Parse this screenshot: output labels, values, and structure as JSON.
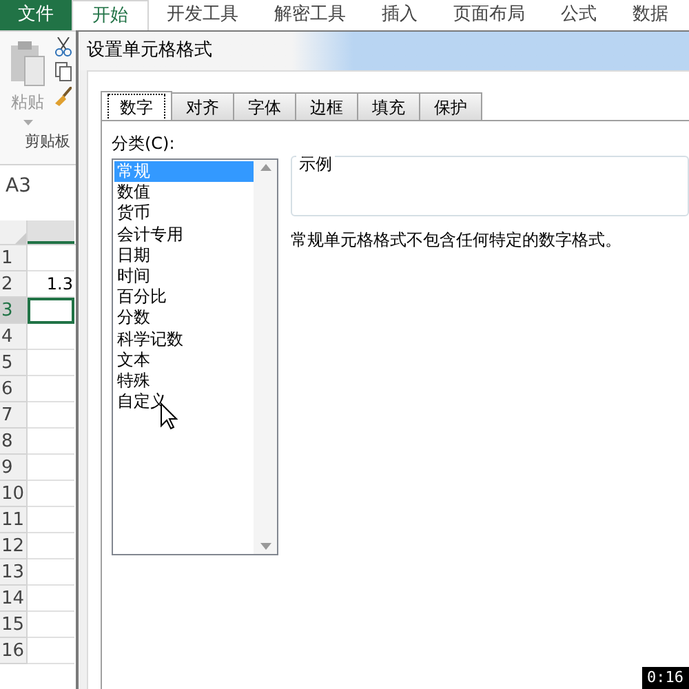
{
  "ribbon_tabs": [
    {
      "label": "文件",
      "kind": "file"
    },
    {
      "label": "开始",
      "kind": "tab",
      "selected": true
    },
    {
      "label": "开发工具",
      "kind": "tab",
      "selected": false
    },
    {
      "label": "解密工具",
      "kind": "tab",
      "selected": false
    },
    {
      "label": "插入",
      "kind": "tab",
      "selected": false
    },
    {
      "label": "页面布局",
      "kind": "tab",
      "selected": false
    },
    {
      "label": "公式",
      "kind": "tab",
      "selected": false
    },
    {
      "label": "数据",
      "kind": "tab",
      "selected": false
    }
  ],
  "clipboard_group": {
    "paste_label": "粘贴",
    "group_label": "剪贴板"
  },
  "name_box": {
    "value": "A3"
  },
  "sheet": {
    "rows": [
      {
        "header": "1",
        "selected": false
      },
      {
        "header": "2",
        "cell_a": "1.3",
        "selected": false
      },
      {
        "header": "3",
        "selected": true
      },
      {
        "header": "4",
        "selected": false
      },
      {
        "header": "5",
        "selected": false
      },
      {
        "header": "6",
        "selected": false
      },
      {
        "header": "7",
        "selected": false
      },
      {
        "header": "8",
        "selected": false
      },
      {
        "header": "9",
        "selected": false
      },
      {
        "header": "10",
        "selected": false
      },
      {
        "header": "11",
        "selected": false
      },
      {
        "header": "12",
        "selected": false
      },
      {
        "header": "13",
        "selected": false
      },
      {
        "header": "14",
        "selected": false
      },
      {
        "header": "15",
        "selected": false
      },
      {
        "header": "16",
        "selected": false
      }
    ]
  },
  "dialog": {
    "title": "设置单元格格式",
    "tabs": [
      {
        "label": "数字",
        "selected": true
      },
      {
        "label": "对齐",
        "selected": false
      },
      {
        "label": "字体",
        "selected": false
      },
      {
        "label": "边框",
        "selected": false
      },
      {
        "label": "填充",
        "selected": false
      },
      {
        "label": "保护",
        "selected": false
      }
    ],
    "category_label": "分类(C):",
    "categories": [
      {
        "label": "常规",
        "selected": true
      },
      {
        "label": "数值",
        "selected": false
      },
      {
        "label": "货币",
        "selected": false
      },
      {
        "label": "会计专用",
        "selected": false
      },
      {
        "label": "日期",
        "selected": false
      },
      {
        "label": "时间",
        "selected": false
      },
      {
        "label": "百分比",
        "selected": false
      },
      {
        "label": "分数",
        "selected": false
      },
      {
        "label": "科学记数",
        "selected": false
      },
      {
        "label": "文本",
        "selected": false
      },
      {
        "label": "特殊",
        "selected": false
      },
      {
        "label": "自定义",
        "selected": false
      }
    ],
    "sample_label": "示例",
    "description": "常规单元格格式不包含任何特定的数字格式。"
  },
  "video_time": "0:16"
}
